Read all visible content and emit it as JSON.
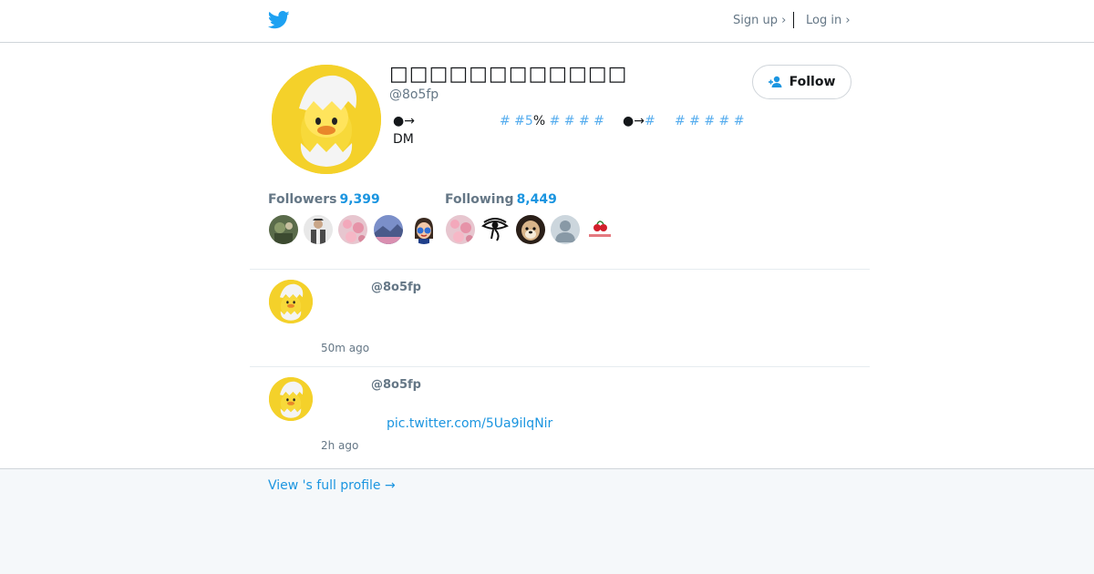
{
  "header": {
    "logo": "twitter-bird-icon",
    "signup_label": "Sign up ›",
    "login_label": "Log in ›"
  },
  "profile": {
    "display_name": "□□□□□□□□□□□□",
    "handle": "@8o5fp",
    "follow_label": "Follow",
    "bio": {
      "seg1": "●→",
      "seg2_a": "# #",
      "seg2_b": "5",
      "seg2_c": "%",
      "seg2_d": " # # # #",
      "seg3_a": "●→",
      "seg3_b": "#",
      "seg4": "# # # # #",
      "line2": "DM"
    }
  },
  "stats": {
    "followers_label": "Followers",
    "followers_count": "9,399",
    "following_label": "Following",
    "following_count": "8,449"
  },
  "tweets": [
    {
      "handle": "@8o5fp",
      "link": "",
      "time": "50m ago"
    },
    {
      "handle": "@8o5fp",
      "link": "pic.twitter.com/5Ua9ilqNir",
      "time": "2h ago"
    }
  ],
  "footer": {
    "view_full_label": "View 's full profile →"
  },
  "colors": {
    "accent": "#1b95e0",
    "hashtag": "#55acee",
    "avatar_bg": "#f4d12a",
    "text": "#14171a",
    "muted": "#657786",
    "page_bg": "#f5f8fa"
  }
}
